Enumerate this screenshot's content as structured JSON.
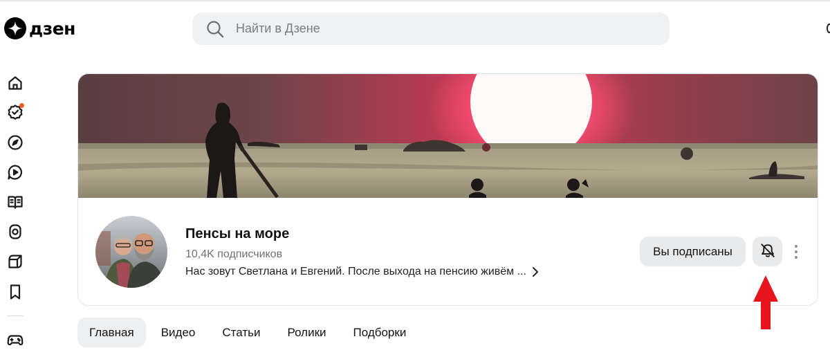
{
  "header": {
    "logo_text": "дзен",
    "search": {
      "placeholder": "Найти в Дзене",
      "value": ""
    }
  },
  "sidebar": {
    "items": [
      {
        "icon": "home-icon"
      },
      {
        "icon": "subscriptions-icon",
        "has_notification": true
      },
      {
        "icon": "compass-icon"
      },
      {
        "icon": "video-icon"
      },
      {
        "icon": "articles-book-icon"
      },
      {
        "icon": "shorts-icon"
      },
      {
        "icon": "cube-icon"
      },
      {
        "icon": "bookmark-icon"
      },
      {
        "icon": "gamepad-icon"
      }
    ]
  },
  "channel": {
    "name": "Пенсы на море",
    "subscribers": "10,4K подписчиков",
    "description": "Нас зовут Светлана и Евгений. После выхода на пенсию живём ...",
    "subscribed_label": "Вы подписаны",
    "bell_icon": "bell-off-icon",
    "more_icon": "more-vertical-icon"
  },
  "tabs": [
    {
      "label": "Главная",
      "active": true
    },
    {
      "label": "Видео",
      "active": false
    },
    {
      "label": "Статьи",
      "active": false
    },
    {
      "label": "Ролики",
      "active": false
    },
    {
      "label": "Подборки",
      "active": false
    }
  ],
  "colors": {
    "accent_notification": "#ff5a1f",
    "annotation_arrow": "#e8141c",
    "button_bg": "#e9eaec",
    "search_bg": "#f0f1f3"
  }
}
